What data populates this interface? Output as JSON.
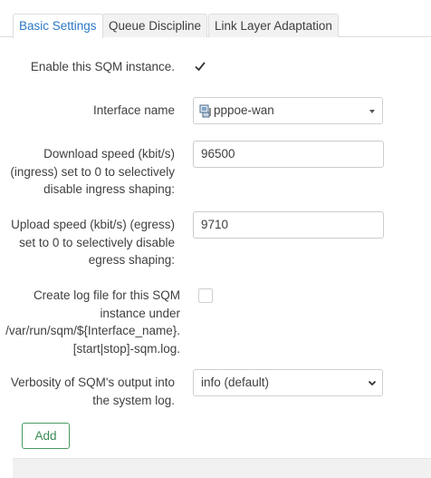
{
  "tabs": [
    {
      "label": "Basic Settings"
    },
    {
      "label": "Queue Discipline"
    },
    {
      "label": "Link Layer Adaptation"
    }
  ],
  "fields": {
    "enable": {
      "label": "Enable this SQM instance.",
      "checked": true
    },
    "interface": {
      "label": "Interface name",
      "value": "pppoe-wan"
    },
    "download": {
      "label_lines": [
        "Download speed (kbit/s)",
        "(ingress) set to 0 to selectively",
        "disable ingress shaping:"
      ],
      "value": "96500"
    },
    "upload": {
      "label_lines": [
        "Upload speed (kbit/s) (egress)",
        "set to 0 to selectively disable",
        "egress shaping:"
      ],
      "value": "9710"
    },
    "logfile": {
      "label_lines": [
        "Create log file for this SQM",
        "instance under",
        "/var/run/sqm/${Interface_name}.",
        "[start|stop]-sqm.log."
      ],
      "checked": false
    },
    "verbosity": {
      "label_lines": [
        "Verbosity of SQM's output into",
        "the system log."
      ],
      "value": "info (default)"
    }
  },
  "actions": {
    "add_label": "Add"
  },
  "colors": {
    "accent": "#2b78c7",
    "add_border": "#4a9a62"
  },
  "icons": {
    "interface": "network-interface-icon",
    "check": "check-icon",
    "dropdown": "chevron-down-icon"
  }
}
